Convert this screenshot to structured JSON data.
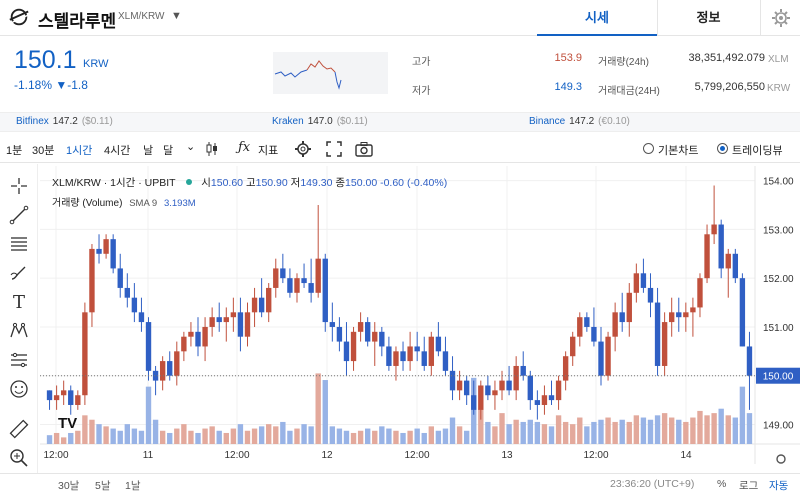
{
  "header": {
    "coin_name": "스텔라루멘",
    "pair": "XLM/KRW",
    "tabs": [
      {
        "label": "시세",
        "active": true
      },
      {
        "label": "정보",
        "active": false
      }
    ]
  },
  "ticker": {
    "price": "150.1",
    "unit": "KRW",
    "change": "-1.18% ▼-1.8",
    "high_label": "고가",
    "high_value": "153.9",
    "low_label": "저가",
    "low_value": "149.3",
    "volume_label": "거래량(24h)",
    "volume_value": "38,351,492.079",
    "volume_unit": "XLM",
    "amount_label": "거래대금(24H)",
    "amount_value": "5,799,206,550",
    "amount_unit": "KRW"
  },
  "exchanges": [
    {
      "name": "Bitfinex",
      "price": "147.2",
      "diff": "($0.11)"
    },
    {
      "name": "Kraken",
      "price": "147.0",
      "diff": "($0.11)"
    },
    {
      "name": "Binance",
      "price": "147.2",
      "diff": "(€0.10)"
    }
  ],
  "toolbar": {
    "intervals": [
      {
        "label": "1분",
        "selected": false
      },
      {
        "label": "30분",
        "selected": false
      },
      {
        "label": "1시간",
        "selected": true
      },
      {
        "label": "4시간",
        "selected": false
      },
      {
        "label": "날",
        "selected": false
      },
      {
        "label": "달",
        "selected": false
      }
    ],
    "indicator_label": "지표",
    "basic_chart": "기본차트",
    "trading_view": "트레이딩뷰"
  },
  "legend": {
    "title": "XLM/KRW · 1시간 · UPBIT",
    "o_label": "시",
    "o": "150.60",
    "h_label": "고",
    "h": "150.90",
    "l_label": "저",
    "l": "149.30",
    "c_label": "종",
    "c": "150.00",
    "chg": "-0.60 (-0.40%)",
    "volume_label": "거래량 (Volume)",
    "sma_label": "SMA 9",
    "sma_value": "3.193M"
  },
  "bottom": {
    "ranges": [
      "30날",
      "5날",
      "1날"
    ],
    "clock": "23:36:20 (UTC+9)",
    "percent": "%",
    "log": "로그",
    "auto": "자동"
  },
  "colors": {
    "up": "#c0503c",
    "down": "#2f5fc4",
    "accent": "#1261c4"
  },
  "chart_data": {
    "type": "candlestick",
    "y_ticks": [
      "154.00",
      "153.00",
      "152.00",
      "151.00",
      "150.00",
      "149.00"
    ],
    "ylim": [
      148.6,
      154.3
    ],
    "x_ticks": [
      "12:00",
      "11",
      "12:00",
      "12",
      "12:00",
      "13",
      "12:00",
      "14"
    ],
    "last_price": "150.00",
    "candles": [
      [
        149.7,
        149.7,
        149.3,
        149.5
      ],
      [
        149.5,
        149.8,
        149.3,
        149.6
      ],
      [
        149.6,
        149.9,
        149.4,
        149.7
      ],
      [
        149.7,
        149.8,
        149.2,
        149.4
      ],
      [
        149.4,
        149.7,
        149.3,
        149.6
      ],
      [
        149.6,
        151.5,
        149.4,
        151.3
      ],
      [
        151.3,
        152.7,
        151.0,
        152.6
      ],
      [
        152.6,
        152.9,
        152.3,
        152.5
      ],
      [
        152.5,
        152.9,
        152.4,
        152.8
      ],
      [
        152.8,
        152.9,
        152.1,
        152.2
      ],
      [
        152.2,
        152.5,
        151.6,
        151.8
      ],
      [
        151.8,
        152.1,
        151.4,
        151.6
      ],
      [
        151.6,
        151.9,
        151.1,
        151.3
      ],
      [
        151.3,
        151.6,
        150.9,
        151.1
      ],
      [
        151.1,
        151.2,
        149.9,
        150.1
      ],
      [
        150.1,
        150.2,
        149.6,
        149.9
      ],
      [
        149.9,
        150.4,
        149.7,
        150.3
      ],
      [
        150.3,
        150.5,
        149.9,
        150.0
      ],
      [
        150.0,
        150.7,
        149.8,
        150.5
      ],
      [
        150.5,
        150.9,
        150.3,
        150.8
      ],
      [
        150.8,
        151.1,
        150.6,
        150.9
      ],
      [
        150.9,
        151.2,
        150.4,
        150.6
      ],
      [
        150.6,
        151.2,
        150.3,
        151.0
      ],
      [
        151.0,
        151.4,
        150.8,
        151.2
      ],
      [
        151.2,
        151.5,
        150.9,
        151.1
      ],
      [
        151.1,
        151.4,
        150.7,
        151.2
      ],
      [
        151.2,
        151.6,
        150.9,
        151.3
      ],
      [
        151.3,
        151.6,
        150.5,
        150.8
      ],
      [
        150.8,
        151.5,
        150.6,
        151.3
      ],
      [
        151.3,
        151.8,
        151.0,
        151.6
      ],
      [
        151.6,
        152.0,
        151.2,
        151.3
      ],
      [
        151.3,
        151.9,
        151.1,
        151.8
      ],
      [
        151.8,
        152.4,
        151.6,
        152.2
      ],
      [
        152.2,
        152.5,
        151.9,
        152.0
      ],
      [
        152.0,
        152.2,
        151.6,
        151.7
      ],
      [
        151.7,
        152.1,
        151.5,
        152.0
      ],
      [
        152.0,
        152.3,
        151.8,
        151.9
      ],
      [
        151.9,
        152.4,
        151.5,
        151.7
      ],
      [
        151.7,
        153.5,
        151.6,
        152.4
      ],
      [
        152.4,
        152.5,
        150.9,
        151.1
      ],
      [
        151.1,
        151.5,
        150.7,
        151.0
      ],
      [
        151.0,
        151.2,
        150.5,
        150.7
      ],
      [
        150.7,
        151.1,
        150.0,
        150.3
      ],
      [
        150.3,
        151.0,
        150.1,
        150.9
      ],
      [
        150.9,
        151.3,
        150.7,
        151.1
      ],
      [
        151.1,
        151.2,
        150.6,
        150.7
      ],
      [
        150.7,
        151.1,
        150.2,
        150.9
      ],
      [
        150.9,
        151.0,
        150.4,
        150.6
      ],
      [
        150.6,
        150.8,
        150.1,
        150.2
      ],
      [
        150.2,
        150.6,
        149.9,
        150.5
      ],
      [
        150.5,
        150.7,
        150.1,
        150.3
      ],
      [
        150.3,
        150.9,
        150.1,
        150.6
      ],
      [
        150.6,
        150.9,
        150.3,
        150.5
      ],
      [
        150.5,
        150.8,
        150.1,
        150.2
      ],
      [
        150.2,
        150.9,
        150.0,
        150.8
      ],
      [
        150.8,
        151.1,
        150.4,
        150.5
      ],
      [
        150.5,
        150.8,
        150.0,
        150.1
      ],
      [
        150.1,
        150.4,
        149.5,
        149.7
      ],
      [
        149.7,
        150.1,
        149.5,
        149.9
      ],
      [
        149.9,
        150.0,
        149.4,
        149.6
      ],
      [
        149.6,
        149.9,
        149.2,
        149.3
      ],
      [
        149.3,
        149.9,
        149.1,
        149.8
      ],
      [
        149.8,
        150.0,
        149.5,
        149.6
      ],
      [
        149.6,
        149.9,
        149.3,
        149.7
      ],
      [
        149.7,
        150.1,
        149.5,
        149.9
      ],
      [
        149.9,
        150.2,
        149.6,
        149.7
      ],
      [
        149.7,
        150.4,
        149.5,
        150.2
      ],
      [
        150.2,
        150.5,
        149.9,
        150.0
      ],
      [
        150.0,
        150.1,
        149.3,
        149.5
      ],
      [
        149.5,
        149.7,
        149.1,
        149.4
      ],
      [
        149.4,
        149.8,
        149.2,
        149.6
      ],
      [
        149.6,
        149.9,
        149.4,
        149.5
      ],
      [
        149.5,
        150.0,
        149.3,
        149.9
      ],
      [
        149.9,
        150.5,
        149.7,
        150.4
      ],
      [
        150.4,
        150.9,
        150.2,
        150.8
      ],
      [
        150.8,
        151.3,
        150.6,
        151.2
      ],
      [
        151.2,
        151.3,
        150.9,
        151.0
      ],
      [
        151.0,
        151.4,
        150.6,
        150.7
      ],
      [
        150.7,
        151.0,
        149.8,
        150.0
      ],
      [
        150.0,
        150.9,
        149.9,
        150.8
      ],
      [
        150.8,
        151.5,
        150.5,
        151.3
      ],
      [
        151.3,
        151.7,
        150.9,
        151.1
      ],
      [
        151.1,
        151.9,
        150.8,
        151.7
      ],
      [
        151.7,
        152.3,
        151.5,
        152.1
      ],
      [
        152.1,
        152.4,
        151.7,
        151.8
      ],
      [
        151.8,
        152.1,
        151.2,
        151.5
      ],
      [
        151.5,
        151.8,
        150.0,
        150.2
      ],
      [
        150.2,
        151.3,
        150.0,
        151.1
      ],
      [
        151.1,
        151.6,
        150.8,
        151.3
      ],
      [
        151.3,
        151.6,
        150.9,
        151.2
      ],
      [
        151.2,
        151.5,
        150.9,
        151.3
      ],
      [
        151.3,
        151.6,
        150.8,
        151.4
      ],
      [
        151.4,
        152.1,
        151.2,
        152.0
      ],
      [
        152.0,
        153.1,
        151.9,
        152.9
      ],
      [
        152.9,
        153.9,
        152.7,
        153.1
      ],
      [
        153.1,
        153.2,
        152.0,
        152.2
      ],
      [
        152.2,
        152.6,
        151.6,
        152.5
      ],
      [
        152.5,
        152.6,
        151.9,
        152.0
      ],
      [
        152.0,
        152.1,
        150.6,
        150.6
      ],
      [
        150.6,
        150.9,
        149.3,
        150.0
      ]
    ],
    "volumes": [
      0.4,
      0.5,
      0.3,
      0.5,
      0.6,
      1.3,
      1.1,
      0.9,
      0.8,
      0.7,
      0.6,
      0.9,
      0.7,
      0.6,
      2.6,
      1.1,
      0.6,
      0.5,
      0.7,
      0.9,
      0.6,
      0.5,
      0.7,
      0.8,
      0.6,
      0.5,
      0.7,
      0.9,
      0.6,
      0.7,
      0.8,
      0.9,
      0.8,
      1.0,
      0.6,
      0.7,
      0.9,
      0.8,
      3.2,
      2.9,
      0.8,
      0.7,
      0.6,
      0.5,
      0.6,
      0.7,
      0.6,
      0.8,
      0.7,
      0.6,
      0.5,
      0.6,
      0.7,
      0.5,
      0.8,
      0.6,
      0.7,
      1.2,
      0.8,
      0.6,
      3.0,
      1.6,
      1.0,
      0.8,
      1.4,
      0.9,
      1.1,
      1.0,
      1.1,
      1.0,
      0.9,
      0.8,
      1.3,
      1.0,
      0.9,
      1.2,
      0.8,
      1.0,
      1.1,
      1.2,
      1.0,
      1.1,
      1.0,
      1.3,
      1.2,
      1.1,
      1.3,
      1.4,
      1.2,
      1.1,
      1.0,
      1.2,
      1.5,
      1.3,
      1.4,
      1.6,
      1.3,
      1.2,
      2.6,
      1.4,
      2.0
    ]
  }
}
